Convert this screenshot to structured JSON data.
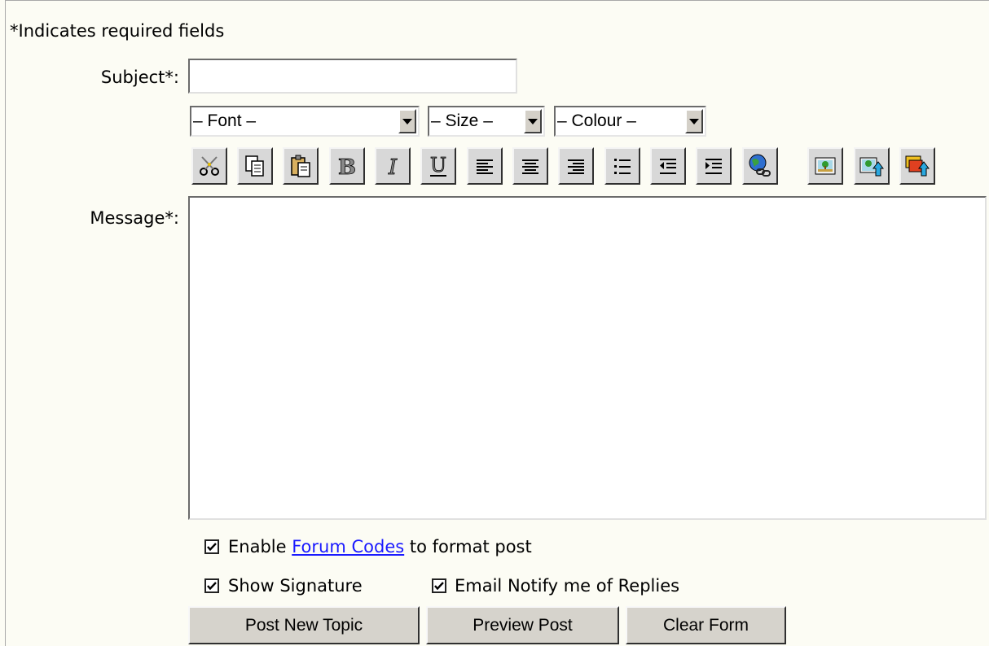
{
  "form": {
    "required_note": "*Indicates required fields",
    "subject_label": "Subject*:",
    "subject_value": "",
    "message_label": "Message*:",
    "message_value": ""
  },
  "toolbar": {
    "font_select": "– Font –",
    "size_select": "– Size –",
    "colour_select": "– Colour –",
    "buttons": [
      "cut-icon",
      "copy-icon",
      "paste-icon",
      "bold-icon",
      "italic-icon",
      "underline-icon",
      "align-left-icon",
      "align-center-icon",
      "align-right-icon",
      "list-icon",
      "outdent-icon",
      "indent-icon",
      "hyperlink-icon",
      "image-icon",
      "upload-image-icon",
      "upload-file-icon"
    ]
  },
  "options": {
    "forum_codes_before": "Enable ",
    "forum_codes_link": "Forum Codes",
    "forum_codes_after": " to format post",
    "forum_codes_checked": true,
    "show_signature": "Show Signature",
    "show_signature_checked": true,
    "email_notify": "Email Notify me of Replies",
    "email_notify_checked": true
  },
  "actions": {
    "post_new_topic": "Post New Topic",
    "preview_post": "Preview Post",
    "clear_form": "Clear Form"
  }
}
